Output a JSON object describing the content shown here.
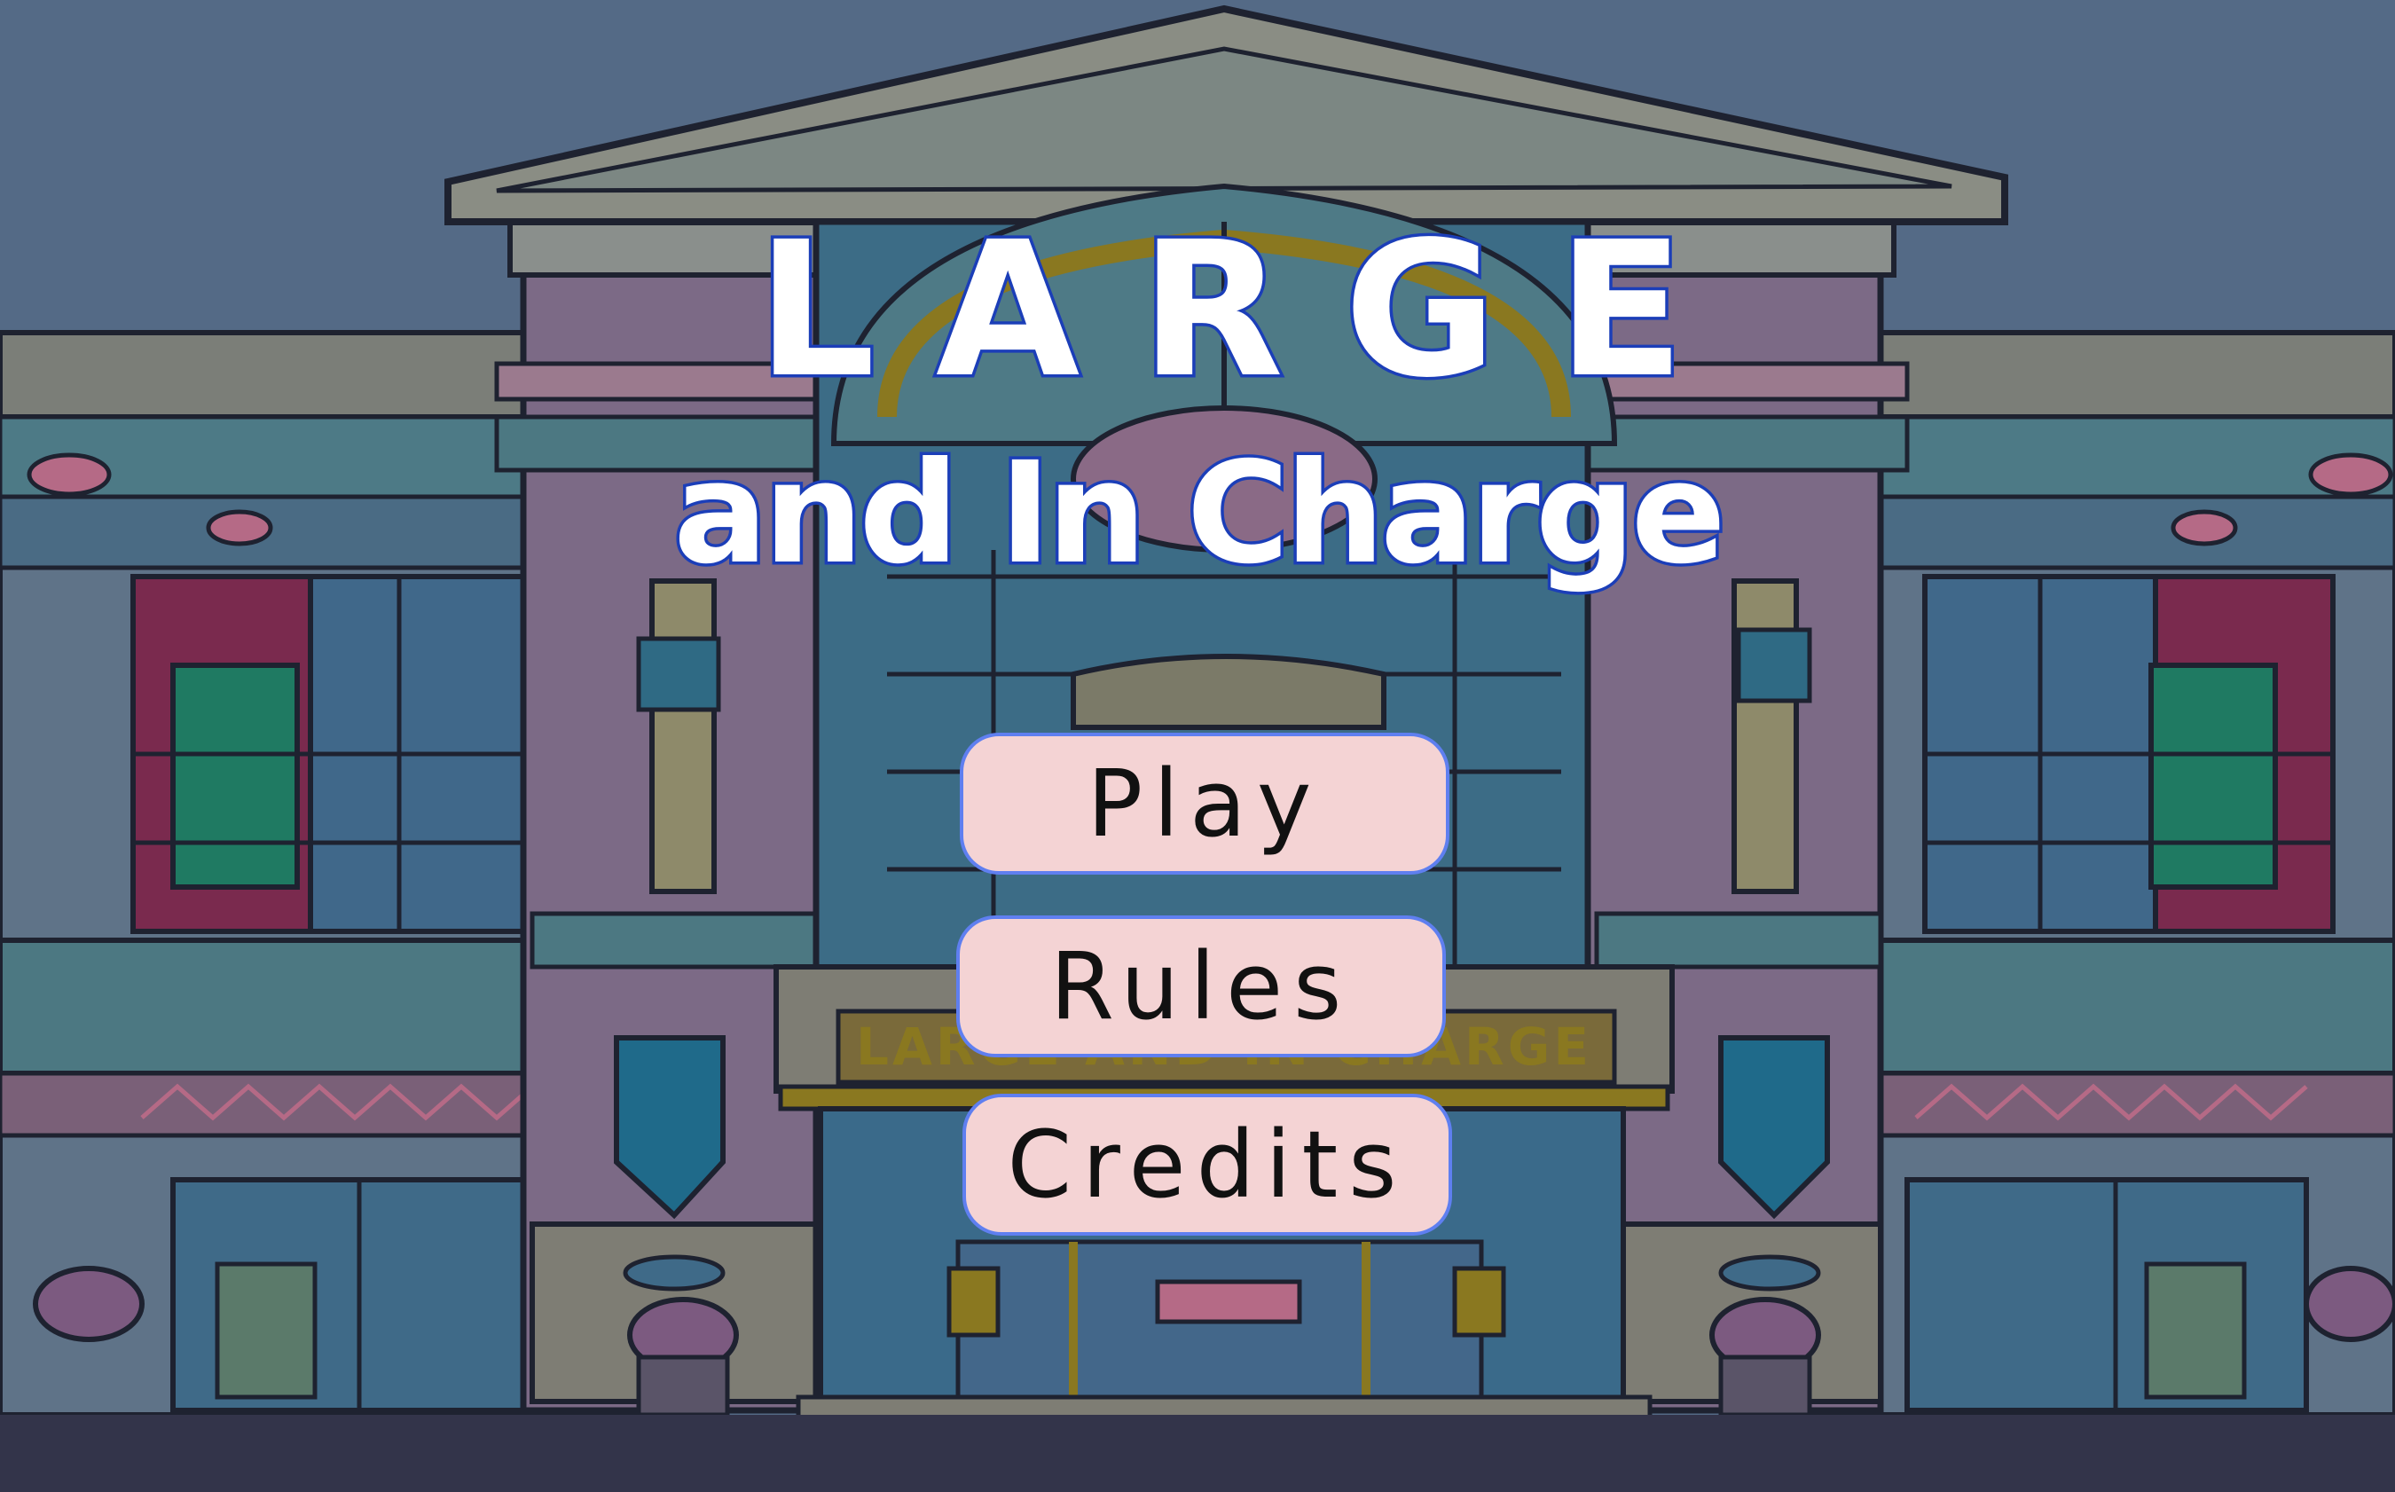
{
  "title": {
    "line1": "LARGE",
    "line2": "and In Charge"
  },
  "menu": {
    "play_label": "Play",
    "rules_label": "Rules",
    "credits_label": "Credits"
  },
  "marquee_text": "LARGE AND IN CHARGE",
  "colors": {
    "sky": "#546a86",
    "title_fill": "#ffffff",
    "title_stroke": "#1c3fb8",
    "button_fill": "#f4d3d4",
    "button_border": "#5f7ff0"
  }
}
